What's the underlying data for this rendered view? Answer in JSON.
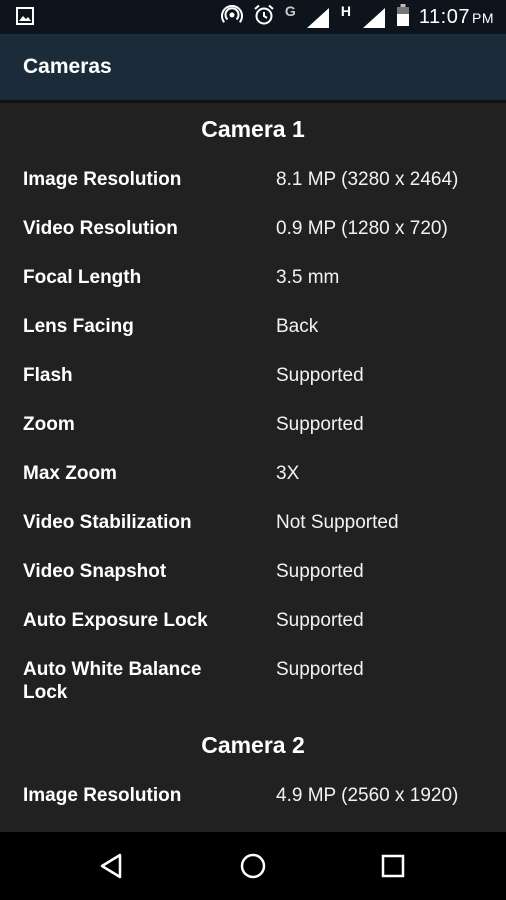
{
  "status_bar": {
    "network_letter_1": "G",
    "network_letter_2": "H",
    "time": "11:07",
    "ampm": "PM"
  },
  "app_bar": {
    "title": "Cameras"
  },
  "sections": [
    {
      "title": "Camera 1",
      "rows": [
        {
          "label": "Image Resolution",
          "value": "8.1 MP (3280 x 2464)"
        },
        {
          "label": "Video Resolution",
          "value": "0.9 MP (1280 x 720)"
        },
        {
          "label": "Focal Length",
          "value": "3.5 mm"
        },
        {
          "label": "Lens Facing",
          "value": "Back"
        },
        {
          "label": "Flash",
          "value": "Supported"
        },
        {
          "label": "Zoom",
          "value": "Supported"
        },
        {
          "label": "Max Zoom",
          "value": "3X"
        },
        {
          "label": "Video Stabilization",
          "value": "Not Supported"
        },
        {
          "label": "Video Snapshot",
          "value": "Supported"
        },
        {
          "label": "Auto Exposure Lock",
          "value": "Supported"
        },
        {
          "label": "Auto White Balance Lock",
          "value": "Supported"
        }
      ]
    },
    {
      "title": "Camera 2",
      "rows": [
        {
          "label": "Image Resolution",
          "value": "4.9 MP (2560 x 1920)"
        }
      ]
    }
  ],
  "icons": {
    "status_left": "image-icon",
    "hotspot": "hotspot-icon",
    "alarm": "alarm-icon",
    "signal": "signal-icon",
    "battery": "battery-icon",
    "nav_back": "back-icon",
    "nav_home": "home-icon",
    "nav_recents": "recents-icon"
  },
  "colors": {
    "status_bar": "#0d141b",
    "app_bar": "#1c2b3a",
    "background": "#212121",
    "nav_bar": "#000000"
  }
}
